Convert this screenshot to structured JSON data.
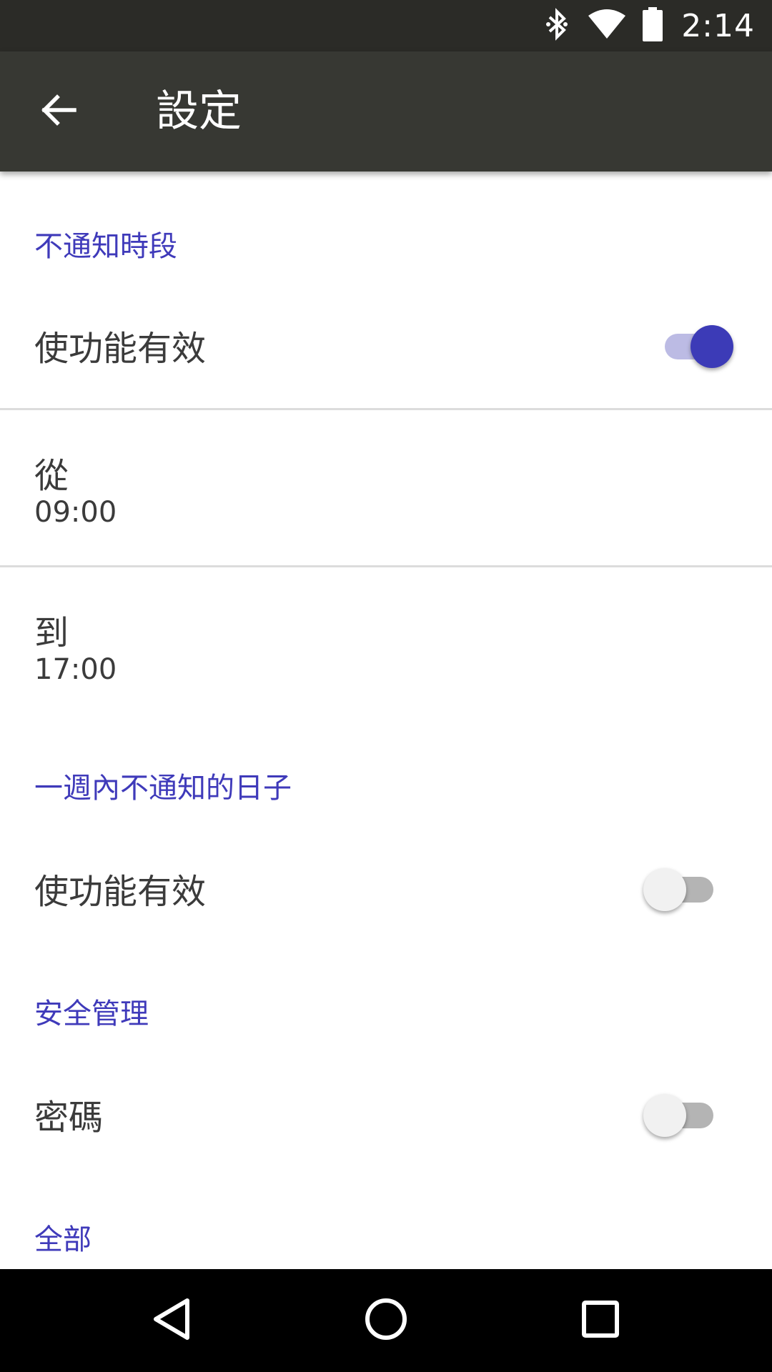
{
  "status_bar": {
    "time": "2:14",
    "icons": [
      "bluetooth-icon",
      "wifi-icon",
      "battery-icon"
    ]
  },
  "app_bar": {
    "back_icon": "arrow-back-icon",
    "title": "設定"
  },
  "sections": {
    "quiet_hours": {
      "header": "不通知時段",
      "enable_label": "使功能有效",
      "enable_state": true,
      "from_label": "從",
      "from_value": "09:00",
      "to_label": "到",
      "to_value": "17:00"
    },
    "quiet_days": {
      "header": "一週內不通知的日子",
      "enable_label": "使功能有效",
      "enable_state": false
    },
    "security": {
      "header": "安全管理",
      "password_label": "密碼",
      "password_state": false
    },
    "all": {
      "header": "全部"
    }
  },
  "colors": {
    "accent": "#3c3bb7",
    "app_bar": "#373833",
    "status_bar": "#2b2b27"
  },
  "nav_bar": {
    "icons": [
      "back-triangle-icon",
      "home-circle-icon",
      "recents-square-icon"
    ]
  }
}
